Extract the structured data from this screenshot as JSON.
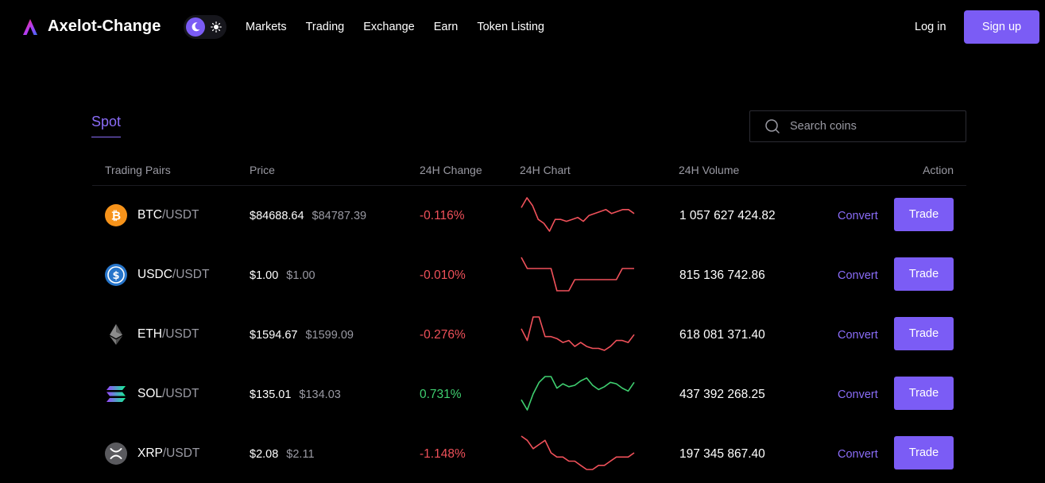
{
  "header": {
    "brand": "Axelot-Change",
    "nav": [
      "Markets",
      "Trading",
      "Exchange",
      "Earn",
      "Token Listing"
    ],
    "login": "Log in",
    "signup": "Sign up"
  },
  "tabs": {
    "spot": "Spot"
  },
  "search": {
    "placeholder": "Search coins",
    "value": ""
  },
  "table": {
    "headers": [
      "Trading Pairs",
      "Price",
      "24H Change",
      "24H Chart",
      "24H Volume",
      "Action"
    ],
    "rows": [
      {
        "base": "BTC",
        "quote": "/USDT",
        "icon": "bitcoin-icon",
        "price": "$84688.64",
        "prev_price": "$84787.39",
        "change": "-0.116%",
        "trend": "down",
        "volume": "1 057 627 424.82",
        "convert": "Convert",
        "trade": "Trade",
        "spark": [
          40,
          45,
          41,
          34,
          32,
          28,
          34,
          34,
          33,
          34,
          35,
          33,
          36,
          37,
          38,
          39,
          37,
          38,
          39,
          39,
          37
        ]
      },
      {
        "base": "USDC",
        "quote": "/USDT",
        "icon": "usdc-icon",
        "price": "$1.00",
        "prev_price": "$1.00",
        "change": "-0.010%",
        "trend": "down",
        "volume": "815 136 742.86",
        "convert": "Convert",
        "trade": "Trade",
        "spark": [
          1.004,
          1.002,
          1.002,
          1.002,
          1.002,
          1.002,
          0.998,
          0.998,
          0.998,
          1.0,
          1.0,
          1.0,
          1.0,
          1.0,
          1.0,
          1.0,
          1.0,
          1.002,
          1.002,
          1.002
        ]
      },
      {
        "base": "ETH",
        "quote": "/USDT",
        "icon": "ethereum-icon",
        "price": "$1594.67",
        "prev_price": "$1599.09",
        "change": "-0.276%",
        "trend": "down",
        "volume": "618 081 371.40",
        "convert": "Convert",
        "trade": "Trade",
        "spark": [
          1603,
          1597,
          1609,
          1609,
          1599,
          1599,
          1598,
          1596,
          1597,
          1594,
          1596,
          1594,
          1593,
          1593,
          1592,
          1594,
          1597,
          1597,
          1596,
          1600
        ]
      },
      {
        "base": "SOL",
        "quote": "/USDT",
        "icon": "solana-icon",
        "price": "$135.01",
        "prev_price": "$134.03",
        "change": "0.731%",
        "trend": "up",
        "volume": "437 392 268.25",
        "convert": "Convert",
        "trade": "Trade",
        "spark": [
          133.8,
          133.1,
          134.2,
          135.0,
          135.4,
          135.4,
          134.6,
          134.9,
          134.7,
          134.8,
          135.1,
          135.3,
          134.8,
          134.5,
          134.7,
          135.0,
          134.9,
          134.6,
          134.4,
          135.0
        ]
      },
      {
        "base": "XRP",
        "quote": "/USDT",
        "icon": "xrp-icon",
        "price": "$2.08",
        "prev_price": "$2.11",
        "change": "-1.148%",
        "trend": "down",
        "volume": "197 345 867.40",
        "convert": "Convert",
        "trade": "Trade",
        "spark": [
          2.12,
          2.11,
          2.09,
          2.1,
          2.11,
          2.08,
          2.07,
          2.07,
          2.06,
          2.06,
          2.05,
          2.04,
          2.04,
          2.05,
          2.05,
          2.06,
          2.07,
          2.07,
          2.07,
          2.08
        ]
      }
    ]
  },
  "colors": {
    "accent": "#7b5cf5",
    "negative": "#f0515a",
    "positive": "#3fcf70"
  }
}
